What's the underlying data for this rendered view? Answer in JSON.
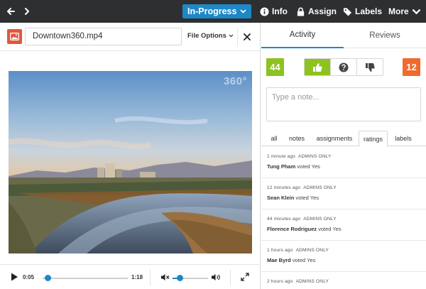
{
  "topbar": {
    "status_label": "In-Progress",
    "info_label": "Info",
    "assign_label": "Assign",
    "labels_label": "Labels",
    "more_label": "More"
  },
  "file": {
    "name": "Downtown360.mp4",
    "options_label": "File Options",
    "badge": "360°"
  },
  "player": {
    "current_time": "0:05",
    "duration": "1:18",
    "progress_fraction": 0.064,
    "volume_fraction": 0.2
  },
  "right": {
    "tabs": [
      {
        "label": "Activity"
      },
      {
        "label": "Reviews"
      }
    ],
    "yes_count": "44",
    "no_count": "12",
    "note_placeholder": "Type a note...",
    "filters": [
      {
        "label": "all"
      },
      {
        "label": "notes"
      },
      {
        "label": "assignments"
      },
      {
        "label": "ratings"
      },
      {
        "label": "labels"
      }
    ],
    "feed": [
      {
        "time": "1 minute ago",
        "scope": "ADMINS ONLY",
        "user": "Tung Pham",
        "action": "voted Yes"
      },
      {
        "time": "12 minutes ago",
        "scope": "ADMINS ONLY",
        "user": "Sean Klein",
        "action": "voted Yes"
      },
      {
        "time": "44 minutes ago",
        "scope": "ADMINS ONLY",
        "user": "Florence Rodriguez",
        "action": "voted Yes"
      },
      {
        "time": "1 hours ago",
        "scope": "ADMINS ONLY",
        "user": "Mae Byrd",
        "action": "voted Yes"
      },
      {
        "time": "2 hours ago",
        "scope": "ADMINS ONLY",
        "user": "",
        "action": ""
      }
    ]
  },
  "colors": {
    "topbar": "#2d2f31",
    "accent": "#1e88c7",
    "yes": "#8dc21f",
    "no": "#ef6a2f",
    "file_icon": "#e0573d"
  },
  "icons": {
    "back": "arrow-left-icon",
    "forward": "chevron-right-icon",
    "info": "info-icon",
    "assign": "lock-icon",
    "labels": "tag-icon",
    "file": "image-icon",
    "close": "close-icon",
    "play": "play-icon",
    "mute": "mute-icon",
    "volume": "volume-icon",
    "expand": "expand-icon",
    "thumbs_up": "thumbs-up-icon",
    "question": "question-icon",
    "thumbs_down": "thumbs-down-icon"
  }
}
